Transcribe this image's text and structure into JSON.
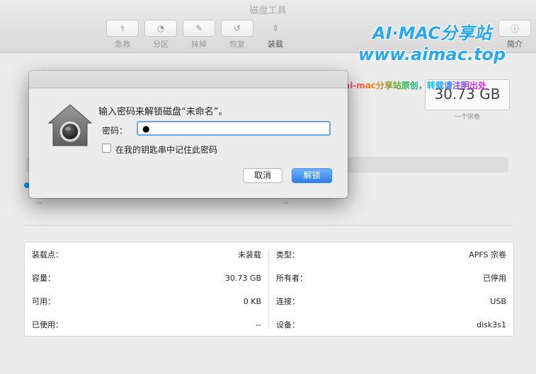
{
  "window": {
    "title": "磁盘工具"
  },
  "toolbar": {
    "items": [
      {
        "label": "急救",
        "icon": "first-aid-icon"
      },
      {
        "label": "分区",
        "icon": "partition-icon"
      },
      {
        "label": "抹掉",
        "icon": "erase-icon"
      },
      {
        "label": "恢复",
        "icon": "restore-icon"
      },
      {
        "label": "装载",
        "icon": "mount-icon"
      }
    ],
    "info_label": "简介"
  },
  "watermark": {
    "line1": "AI·MAC分享站",
    "line2": "www.aimac.top",
    "note": "ai-mac分享站原创，转载请注明出处"
  },
  "volume": {
    "size": "30.73 GB",
    "caption": "一个宗卷",
    "bar_left_value": "--",
    "bar_right_value": "--"
  },
  "dialog": {
    "message": "输入密码来解锁磁盘“未命名”。",
    "password_label": "密码：",
    "password_value": "●",
    "keychain_label": "在我的钥匙串中记住此密码",
    "cancel": "取消",
    "unlock": "解锁"
  },
  "info": {
    "left": [
      {
        "key": "装载点：",
        "value": "未装载"
      },
      {
        "key": "容量：",
        "value": "30.73 GB"
      },
      {
        "key": "可用：",
        "value": "0 KB"
      },
      {
        "key": "已使用：",
        "value": "--"
      }
    ],
    "right": [
      {
        "key": "类型：",
        "value": "APFS 宗卷"
      },
      {
        "key": "所有者：",
        "value": "已停用"
      },
      {
        "key": "连接：",
        "value": "USB"
      },
      {
        "key": "设备：",
        "value": "disk3s1"
      }
    ]
  },
  "colors": {
    "accent": "#2f7fe8",
    "watermark": "#2aa7f4"
  }
}
